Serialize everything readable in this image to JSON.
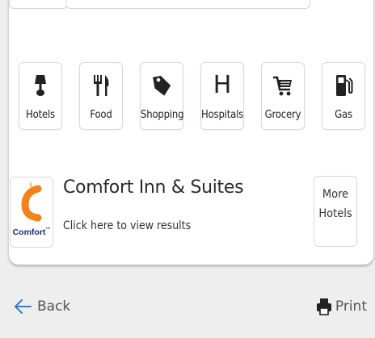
{
  "categories": [
    {
      "label": "Hotels",
      "icon": "lamp-icon"
    },
    {
      "label": "Food",
      "icon": "fork-knife-icon"
    },
    {
      "label": "Shopping",
      "icon": "tag-icon"
    },
    {
      "label": "Hospitals",
      "icon": "hospital-h-icon",
      "glyph": "H"
    },
    {
      "label": "Grocery",
      "icon": "shopping-cart-icon"
    },
    {
      "label": "Gas",
      "icon": "gas-pump-icon"
    }
  ],
  "hotel": {
    "name": "Comfort Inn & Suites",
    "subtitle": "Click here to view results",
    "logo_text": "Comfort",
    "logo_mark": "™"
  },
  "more_hotels": {
    "line1": "More",
    "line2": "Hotels"
  },
  "footer": {
    "back_label": "Back",
    "print_label": "Print"
  },
  "colors": {
    "logo_orange": "#f2811e",
    "logo_navy": "#1b2f6e",
    "link_blue": "#3b79c6"
  }
}
